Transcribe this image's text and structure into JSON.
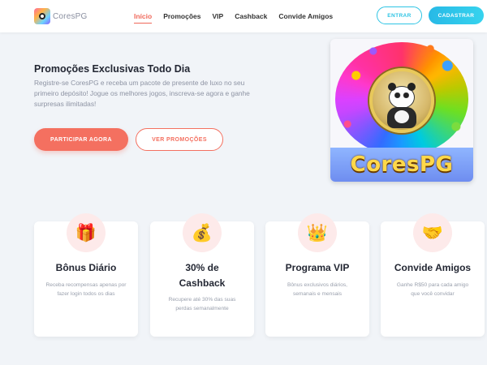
{
  "header": {
    "logo_text": "CoresPG",
    "nav": [
      "Início",
      "Promoções",
      "VIP",
      "Cashback",
      "Convide Amigos"
    ],
    "login_label": "ENTRAR",
    "signup_label": "CADASTRAR",
    "accent_color": "#f0685a",
    "primary_color": "#2ec4e4"
  },
  "hero": {
    "title": "Promoções Exclusivas Todo Dia",
    "text": "Registre-se CoresPG e receba um pacote de presente de luxo no seu primeiro depósito! Jogue os melhores jogos, inscreva-se agora e ganhe surpresas ilimitadas!",
    "cta_primary": "PARTICIPAR AGORA",
    "cta_secondary": "VER PROMOÇÕES",
    "image_banner_text": "CoresPG"
  },
  "features": [
    {
      "icon": "gift-icon",
      "glyph": "🎁",
      "title": "Bônus Diário",
      "desc": "Receba recompensas apenas por fazer login todos os dias"
    },
    {
      "icon": "money-bag-icon",
      "glyph": "💰",
      "title": "30% de Cashback",
      "desc": "Recupere até 30% das suas perdas semanalmente"
    },
    {
      "icon": "crown-icon",
      "glyph": "👑",
      "title": "Programa VIP",
      "desc": "Bônus exclusivos diários, semanais e mensais"
    },
    {
      "icon": "handshake-icon",
      "glyph": "🤝",
      "title": "Convide Amigos",
      "desc": "Ganhe R$50 para cada amigo que você convidar"
    }
  ]
}
